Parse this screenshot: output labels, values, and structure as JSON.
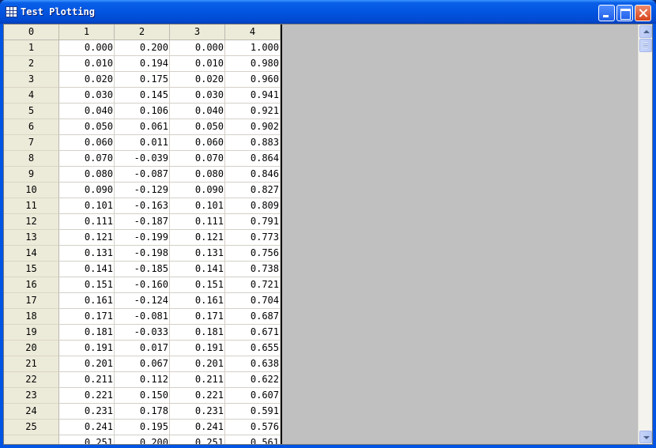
{
  "window": {
    "title": "Test Plotting"
  },
  "table": {
    "headers": [
      "0",
      "1",
      "2",
      "3",
      "4"
    ],
    "rows": [
      [
        "1",
        "0.000",
        "0.200",
        "0.000",
        "1.000"
      ],
      [
        "2",
        "0.010",
        "0.194",
        "0.010",
        "0.980"
      ],
      [
        "3",
        "0.020",
        "0.175",
        "0.020",
        "0.960"
      ],
      [
        "4",
        "0.030",
        "0.145",
        "0.030",
        "0.941"
      ],
      [
        "5",
        "0.040",
        "0.106",
        "0.040",
        "0.921"
      ],
      [
        "6",
        "0.050",
        "0.061",
        "0.050",
        "0.902"
      ],
      [
        "7",
        "0.060",
        "0.011",
        "0.060",
        "0.883"
      ],
      [
        "8",
        "0.070",
        "-0.039",
        "0.070",
        "0.864"
      ],
      [
        "9",
        "0.080",
        "-0.087",
        "0.080",
        "0.846"
      ],
      [
        "10",
        "0.090",
        "-0.129",
        "0.090",
        "0.827"
      ],
      [
        "11",
        "0.101",
        "-0.163",
        "0.101",
        "0.809"
      ],
      [
        "12",
        "0.111",
        "-0.187",
        "0.111",
        "0.791"
      ],
      [
        "13",
        "0.121",
        "-0.199",
        "0.121",
        "0.773"
      ],
      [
        "14",
        "0.131",
        "-0.198",
        "0.131",
        "0.756"
      ],
      [
        "15",
        "0.141",
        "-0.185",
        "0.141",
        "0.738"
      ],
      [
        "16",
        "0.151",
        "-0.160",
        "0.151",
        "0.721"
      ],
      [
        "17",
        "0.161",
        "-0.124",
        "0.161",
        "0.704"
      ],
      [
        "18",
        "0.171",
        "-0.081",
        "0.171",
        "0.687"
      ],
      [
        "19",
        "0.181",
        "-0.033",
        "0.181",
        "0.671"
      ],
      [
        "20",
        "0.191",
        "0.017",
        "0.191",
        "0.655"
      ],
      [
        "21",
        "0.201",
        "0.067",
        "0.201",
        "0.638"
      ],
      [
        "22",
        "0.211",
        "0.112",
        "0.211",
        "0.622"
      ],
      [
        "23",
        "0.221",
        "0.150",
        "0.221",
        "0.607"
      ],
      [
        "24",
        "0.231",
        "0.178",
        "0.231",
        "0.591"
      ],
      [
        "25",
        "0.241",
        "0.195",
        "0.241",
        "0.576"
      ],
      [
        "",
        "0.251",
        "0.200",
        "0.251",
        "0.561"
      ]
    ]
  },
  "colors": {
    "titlebar": "#0255e0",
    "header_bg": "#ecead9",
    "empty_area": "#c0c0c0"
  },
  "icons": {
    "app": "table-grid-icon",
    "minimize": "minimize-icon",
    "maximize": "maximize-icon",
    "close": "close-icon",
    "scroll_up": "scroll-up-arrow-icon",
    "scroll_down": "scroll-down-arrow-icon"
  }
}
